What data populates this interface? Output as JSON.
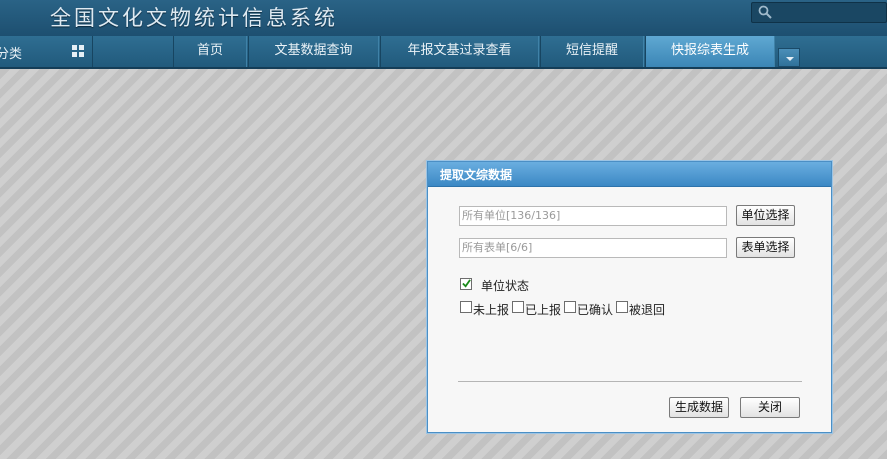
{
  "header": {
    "title": "全国文化文物统计信息系统",
    "search": {
      "placeholder": "",
      "value": ""
    }
  },
  "nav": {
    "category_label": "分类",
    "tabs": [
      {
        "label": "首页"
      },
      {
        "label": "文基数据查询"
      },
      {
        "label": "年报文基过录查看"
      },
      {
        "label": "短信提醒"
      },
      {
        "label": "快报综表生成",
        "active": true
      }
    ]
  },
  "dialog": {
    "title": "提取文综数据",
    "unit_field": "所有单位[136/136]",
    "unit_button": "单位选择",
    "form_field": "所有表单[6/6]",
    "form_button": "表单选择",
    "unit_status": {
      "label": "单位状态",
      "checked": true
    },
    "status_options": [
      {
        "label": "未上报",
        "checked": false
      },
      {
        "label": "已上报",
        "checked": false
      },
      {
        "label": "已确认",
        "checked": false
      },
      {
        "label": "被退回",
        "checked": false
      }
    ],
    "generate_button": "生成数据",
    "close_button": "关闭"
  },
  "colors": {
    "header_bg": "#1d4f70",
    "nav_active": "#4f9acb",
    "dialog_header": "#4a95cf"
  }
}
